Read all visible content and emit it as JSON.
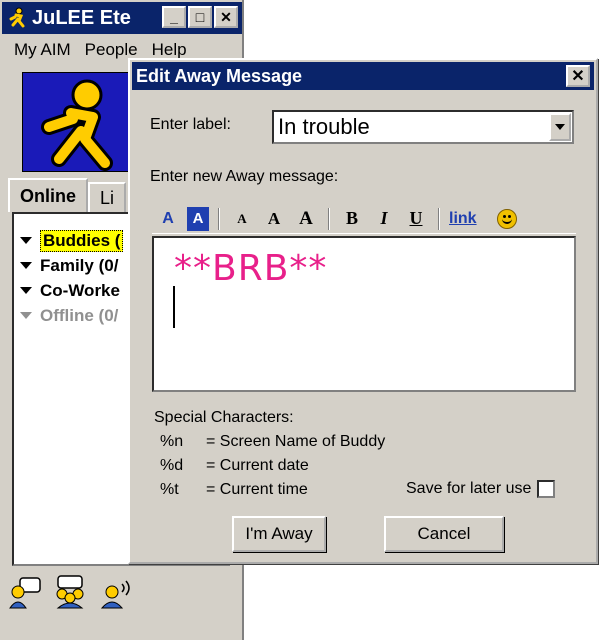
{
  "buddy_window": {
    "title": "JuLEE Ete",
    "menu": [
      "My AIM",
      "People",
      "Help"
    ],
    "tabs": [
      "Online",
      "Li"
    ],
    "groups": [
      {
        "label": "Buddies (",
        "selected": true,
        "offline": false
      },
      {
        "label": "Family (0/",
        "selected": false,
        "offline": false
      },
      {
        "label": "Co-Worke",
        "selected": false,
        "offline": false
      },
      {
        "label": "Offline (0/",
        "selected": false,
        "offline": true
      }
    ]
  },
  "dialog": {
    "title": "Edit Away Message",
    "close_glyph": "✕",
    "label_prompt": "Enter label:",
    "label_value": "In trouble",
    "message_prompt": "Enter new Away message:",
    "toolbar": {
      "font_color": "A",
      "bg_color": "A",
      "smaller": "A",
      "normal": "A",
      "larger": "A",
      "bold": "B",
      "italic": "I",
      "underline": "U",
      "link": "link"
    },
    "message_text": "**BRB**",
    "message_color": "#e8208a",
    "special_title": "Special Characters:",
    "special": [
      {
        "code": "%n",
        "desc": "= Screen Name of Buddy"
      },
      {
        "code": "%d",
        "desc": "= Current date"
      },
      {
        "code": "%t",
        "desc": "= Current time"
      }
    ],
    "save_label": "Save for later use",
    "away_button": "I'm Away",
    "cancel_button": "Cancel"
  }
}
